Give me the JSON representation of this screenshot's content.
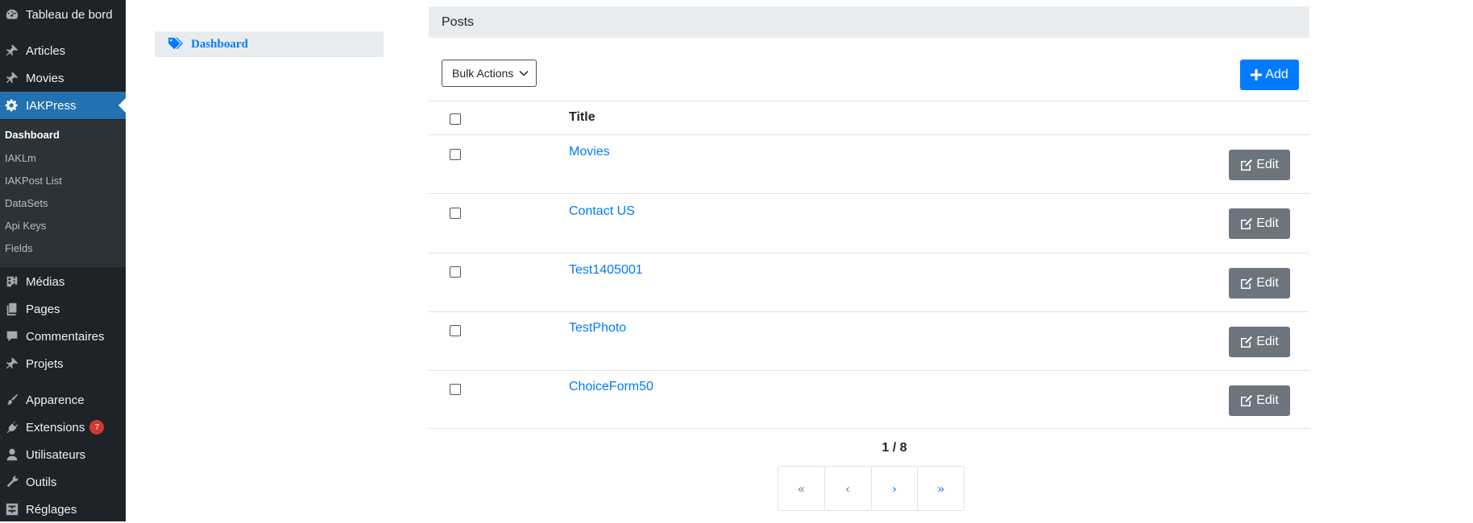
{
  "sidebar": {
    "items": [
      {
        "label": "Tableau de bord",
        "icon": "dashboard-icon"
      },
      {
        "label": "Articles",
        "icon": "pin-icon"
      },
      {
        "label": "Movies",
        "icon": "pin-icon"
      },
      {
        "label": "IAKPress",
        "icon": "gear-icon",
        "active": true
      },
      {
        "label": "Médias",
        "icon": "media-icon"
      },
      {
        "label": "Pages",
        "icon": "pages-icon"
      },
      {
        "label": "Commentaires",
        "icon": "comment-icon"
      },
      {
        "label": "Projets",
        "icon": "pin-icon"
      },
      {
        "label": "Apparence",
        "icon": "brush-icon"
      },
      {
        "label": "Extensions",
        "icon": "plugin-icon",
        "badge": "7"
      },
      {
        "label": "Utilisateurs",
        "icon": "user-icon"
      },
      {
        "label": "Outils",
        "icon": "wrench-icon"
      },
      {
        "label": "Réglages",
        "icon": "settings-icon"
      }
    ],
    "submenu": [
      {
        "label": "Dashboard",
        "current": true
      },
      {
        "label": "IAKLm"
      },
      {
        "label": "IAKPost List"
      },
      {
        "label": "DataSets"
      },
      {
        "label": "Api Keys"
      },
      {
        "label": "Fields"
      }
    ]
  },
  "plugin_nav": {
    "label": "Dashboard",
    "icon": "tags-icon"
  },
  "posts": {
    "header": "Posts",
    "bulk_actions_label": "Bulk Actions",
    "add_label": "Add",
    "column_title": "Title",
    "edit_label": "Edit",
    "rows": [
      {
        "title": "Movies"
      },
      {
        "title": "Contact US"
      },
      {
        "title": "Test1405001"
      },
      {
        "title": "TestPhoto"
      },
      {
        "title": "ChoiceForm50"
      }
    ]
  },
  "pagination": {
    "indicator": "1 / 8",
    "first": "«",
    "prev": "‹",
    "next": "›",
    "last": "»"
  },
  "colors": {
    "sidebar_bg": "#1d2327",
    "sidebar_active": "#2271b1",
    "primary": "#007bff",
    "secondary": "#6c757d",
    "badge": "#d63638"
  }
}
